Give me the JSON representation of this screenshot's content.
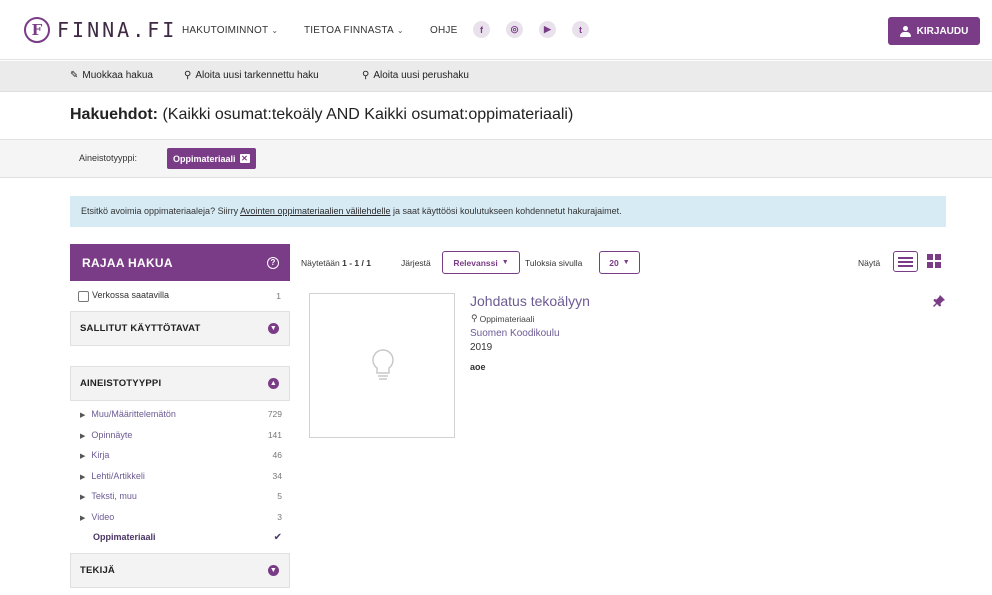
{
  "header": {
    "logo_text": "FINNA.FI",
    "logo_mark": "F",
    "nav": [
      {
        "label": "HAKUTOIMINNOT",
        "has_dropdown": true
      },
      {
        "label": "TIETOA FINNASTA",
        "has_dropdown": true
      },
      {
        "label": "OHJE",
        "has_dropdown": false
      }
    ],
    "social": [
      {
        "name": "facebook-icon",
        "glyph": "f"
      },
      {
        "name": "instagram-icon",
        "glyph": "◎"
      },
      {
        "name": "youtube-icon",
        "glyph": "▶"
      },
      {
        "name": "twitter-icon",
        "glyph": "t"
      }
    ],
    "login_label": "KIRJAUDU"
  },
  "subnav": {
    "edit_search": "Muokkaa hakua",
    "advanced_search": "Aloita uusi tarkennettu haku",
    "basic_search": "Aloita uusi perushaku"
  },
  "search_terms": {
    "label": "Hakuehdot:",
    "query": "(Kaikki osumat:tekoäly AND Kaikki osumat:oppimateriaali)"
  },
  "active_filter": {
    "label": "Aineistotyyppi:",
    "value": "Oppimateriaali"
  },
  "banner": {
    "text_before": "Etsitkö avoimia oppimateriaaleja? Siirry ",
    "link_text": "Avointen oppimateriaalien välilehdelle",
    "text_after": " ja saat käyttöösi koulutukseen kohdennetut hakurajaimet."
  },
  "sidebar": {
    "title": "RAJAA HAKUA",
    "online_label": "Verkossa saatavilla",
    "online_count": "1",
    "facets": [
      {
        "title": "SALLITUT KÄYTTÖTAVAT",
        "expanded": false
      },
      {
        "title": "AINEISTOTYYPPI",
        "expanded": true
      },
      {
        "title": "TEKIJÄ",
        "expanded": false
      }
    ],
    "format_items": [
      {
        "name": "Muu/Määrittelemätön",
        "count": "729"
      },
      {
        "name": "Opinnäyte",
        "count": "141"
      },
      {
        "name": "Kirja",
        "count": "46"
      },
      {
        "name": "Lehti/Artikkeli",
        "count": "34"
      },
      {
        "name": "Teksti, muu",
        "count": "5"
      },
      {
        "name": "Video",
        "count": "3"
      }
    ],
    "selected_item": {
      "name": "Oppimateriaali",
      "mark": "✔"
    }
  },
  "results": {
    "showing_label": "Näytetään",
    "showing_range": "1 - 1 / 1",
    "sort_label": "Järjestä",
    "sort_value": "Relevanssi",
    "per_page_label": "Tuloksia sivulla",
    "per_page_value": "20",
    "view_label": "Näytä"
  },
  "record": {
    "title": "Johdatus tekoälyyn",
    "format": "Oppimateriaali",
    "author": "Suomen Koodikoulu",
    "year": "2019",
    "source": "aoe"
  },
  "colors": {
    "brand": "#7a3c86",
    "link": "#6d5b94",
    "banner": "#d7ebf5"
  }
}
